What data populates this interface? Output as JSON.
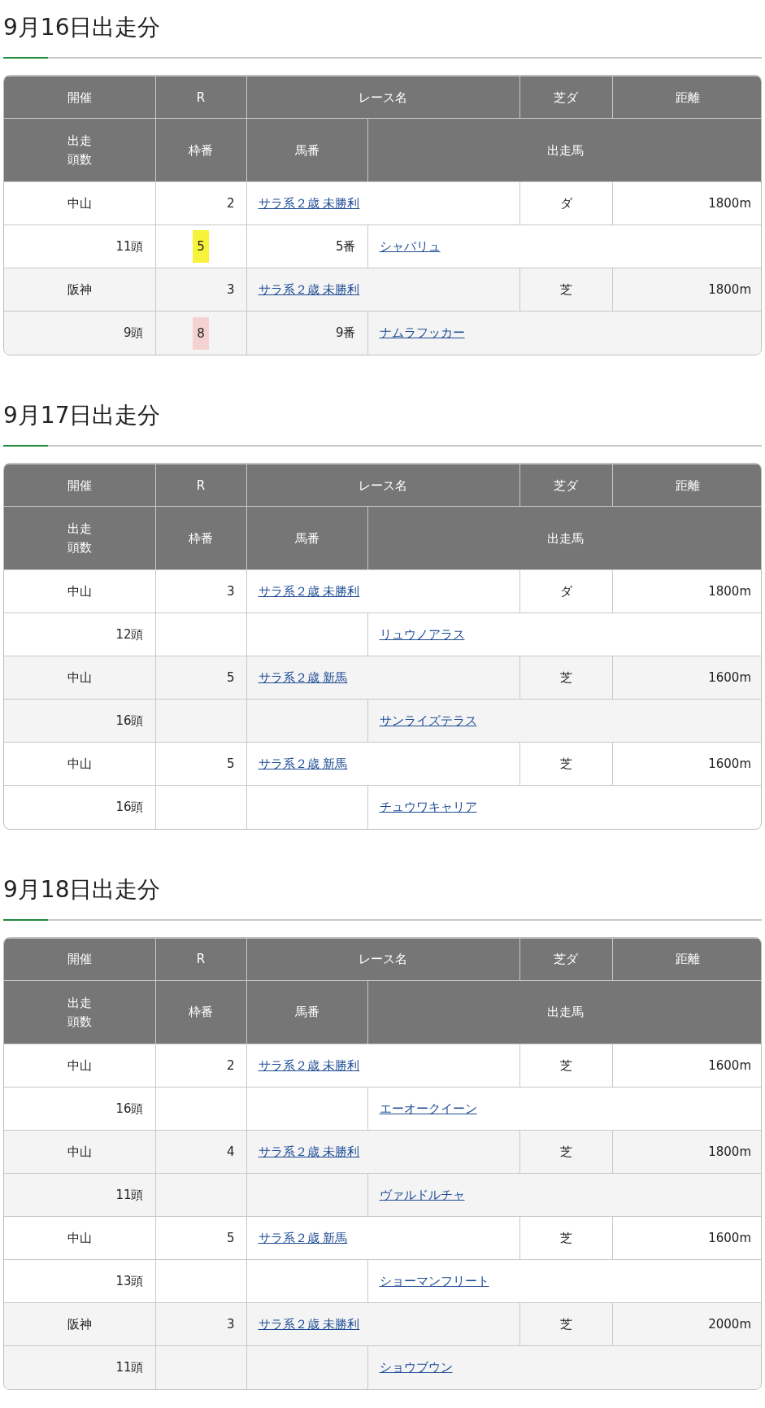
{
  "days": [
    {
      "title": "9月16日出走分",
      "headers": {
        "row1": [
          "開催",
          "R",
          "レース名",
          "芝ダ",
          "距離"
        ],
        "row2": [
          "出走頭数",
          "枠番",
          "馬番",
          "出走馬"
        ]
      },
      "races": [
        {
          "venue": "中山",
          "r": "2",
          "race_name": "サラ系２歳 未勝利",
          "surface": "ダ",
          "distance": "1800m",
          "runners": "11頭",
          "waku": "5",
          "color": "#f7f23a",
          "umaban": "5番",
          "horse": "シャパリュ"
        },
        {
          "venue": "阪神",
          "r": "3",
          "race_name": "サラ系２歳 未勝利",
          "surface": "芝",
          "distance": "1800m",
          "runners": "9頭",
          "waku": "8",
          "color": "#f5d2d2",
          "umaban": "9番",
          "horse": "ナムラフッカー"
        }
      ]
    },
    {
      "title": "9月17日出走分",
      "headers": {
        "row1": [
          "開催",
          "R",
          "レース名",
          "芝ダ",
          "距離"
        ],
        "row2": [
          "出走頭数",
          "枠番",
          "馬番",
          "出走馬"
        ]
      },
      "races": [
        {
          "venue": "中山",
          "r": "3",
          "race_name": "サラ系２歳 未勝利",
          "surface": "ダ",
          "distance": "1800m",
          "runners": "12頭",
          "horse": "リュウノアラス"
        },
        {
          "venue": "中山",
          "r": "5",
          "race_name": "サラ系２歳 新馬",
          "surface": "芝",
          "distance": "1600m",
          "runners": "16頭",
          "horse": "サンライズテラス"
        },
        {
          "venue": "中山",
          "r": "5",
          "race_name": "サラ系２歳 新馬",
          "surface": "芝",
          "distance": "1600m",
          "runners": "16頭",
          "horse": "チュウワキャリア"
        }
      ]
    },
    {
      "title": "9月18日出走分",
      "headers": {
        "row1": [
          "開催",
          "R",
          "レース名",
          "芝ダ",
          "距離"
        ],
        "row2": [
          "出走頭数",
          "枠番",
          "馬番",
          "出走馬"
        ]
      },
      "races": [
        {
          "venue": "中山",
          "r": "2",
          "race_name": "サラ系２歳 未勝利",
          "surface": "芝",
          "distance": "1600m",
          "runners": "16頭",
          "horse": "エーオークイーン"
        },
        {
          "venue": "中山",
          "r": "4",
          "race_name": "サラ系２歳 未勝利",
          "surface": "芝",
          "distance": "1800m",
          "runners": "11頭",
          "horse": "ヴァルドルチャ"
        },
        {
          "venue": "中山",
          "r": "5",
          "race_name": "サラ系２歳 新馬",
          "surface": "芝",
          "distance": "1600m",
          "runners": "13頭",
          "horse": "ショーマンフリート"
        },
        {
          "venue": "阪神",
          "r": "3",
          "race_name": "サラ系２歳 未勝利",
          "surface": "芝",
          "distance": "2000m",
          "runners": "11頭",
          "horse": "ショウブウン"
        }
      ]
    }
  ]
}
